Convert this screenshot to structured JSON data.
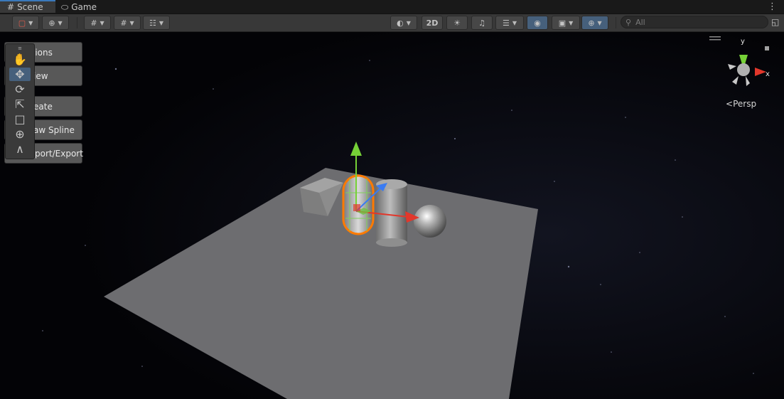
{
  "tabs": [
    {
      "label": "Scene",
      "icon": "grid-icon",
      "active": true
    },
    {
      "label": "Game",
      "icon": "gamepad-icon",
      "active": false
    }
  ],
  "toolbar": {
    "view_mode_2d": "2D",
    "search_placeholder": "All",
    "icons": [
      "transform-tool-icon",
      "global-icon",
      "grid-snap-icon",
      "grid-icon",
      "increment-snap-icon",
      "shading-mode-icon",
      "2d-toggle",
      "lighting-icon",
      "audio-icon",
      "effects-icon",
      "visibility-icon",
      "camera-icon",
      "gizmos-icon",
      "search-icon",
      "maximize-icon"
    ]
  },
  "overlay_menu": {
    "items": [
      "Options",
      "View",
      "Create",
      "Draw Spline",
      "Import/Export"
    ],
    "visible_text": [
      "ptions",
      "iew",
      "eate",
      "aw Spline",
      "port/Export"
    ]
  },
  "tools": [
    "hand-tool",
    "move-tool",
    "rotate-tool",
    "scale-tool",
    "rect-tool",
    "transform-tool",
    "custom-tool"
  ],
  "active_tool": "move-tool",
  "gizmo": {
    "y_label": "y",
    "x_label": "x",
    "projection": "Persp"
  },
  "colors": {
    "accent": "#3a79bb",
    "selection": "#ff7a00",
    "axis_x": "#e2372b",
    "axis_y": "#76d137",
    "axis_z": "#3a7bf2"
  }
}
